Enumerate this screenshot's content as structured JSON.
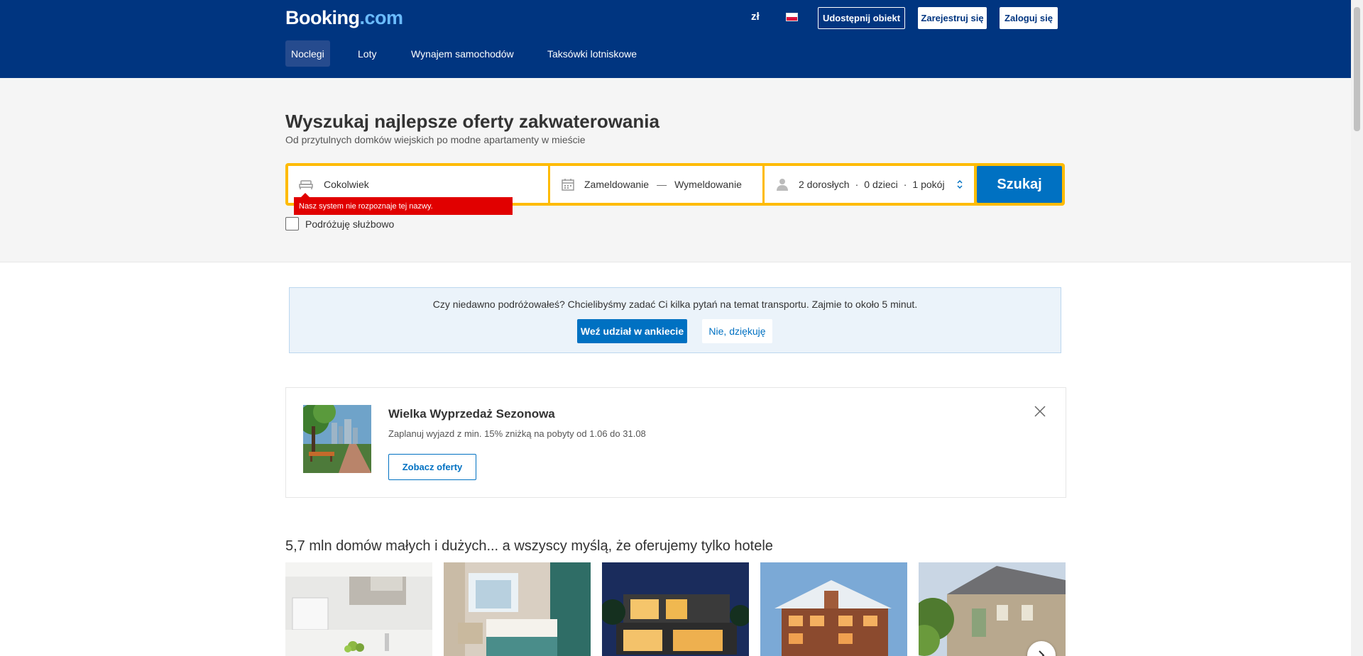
{
  "header": {
    "logo_main": "Booking",
    "logo_suffix": ".com",
    "currency": "zł",
    "language_flag": "polish-flag-icon",
    "list_property_label": "Udostępnij obiekt",
    "register_label": "Zarejestruj się",
    "login_label": "Zaloguj się",
    "nav": [
      {
        "label": "Noclegi",
        "active": true
      },
      {
        "label": "Loty"
      },
      {
        "label": "Wynajem samochodów"
      },
      {
        "label": "Taksówki lotniskowe"
      }
    ]
  },
  "search": {
    "title": "Wyszukaj najlepsze oferty zakwaterowania",
    "subtitle": "Od przytulnych domków wiejskich po modne apartamenty w mieście",
    "destination_value": "Cokolwiek",
    "destination_icon": "bed-icon",
    "checkin_label": "Zameldowanie",
    "date_separator": "—",
    "checkout_label": "Wymeldowanie",
    "calendar_icon": "calendar-icon",
    "guests_icon": "person-icon",
    "adults": "2 dorosłych",
    "children": "0 dzieci",
    "rooms": "1 pokój",
    "dot": "·",
    "search_button": "Szukaj",
    "error_message": "Nasz system nie rozpoznaje tej nazwy.",
    "business_checkbox_label": "Podróżuję służbowo",
    "accent_color": "#febb02",
    "button_color": "#0071c2"
  },
  "survey": {
    "text": "Czy niedawno podróżowałeś? Chcielibyśmy zadać Ci kilka pytań na temat transportu. Zajmie to około 5 minut.",
    "accept_label": "Weź udział w ankiecie",
    "decline_label": "Nie, dziękuję"
  },
  "promo": {
    "title": "Wielka Wyprzedaż Sezonowa",
    "description": "Zaplanuj wyjazd z min. 15% zniżką na pobyty od 1.06 do 31.08",
    "button_label": "Zobacz oferty"
  },
  "properties": {
    "heading": "5,7 mln domów małych i dużych... a wszyscy myślą, że oferujemy tylko hotele",
    "cards": [
      {
        "name": "apartment-kitchen"
      },
      {
        "name": "hotel-room"
      },
      {
        "name": "modern-villa-night"
      },
      {
        "name": "chalet-winter"
      },
      {
        "name": "stone-cottage"
      }
    ]
  }
}
